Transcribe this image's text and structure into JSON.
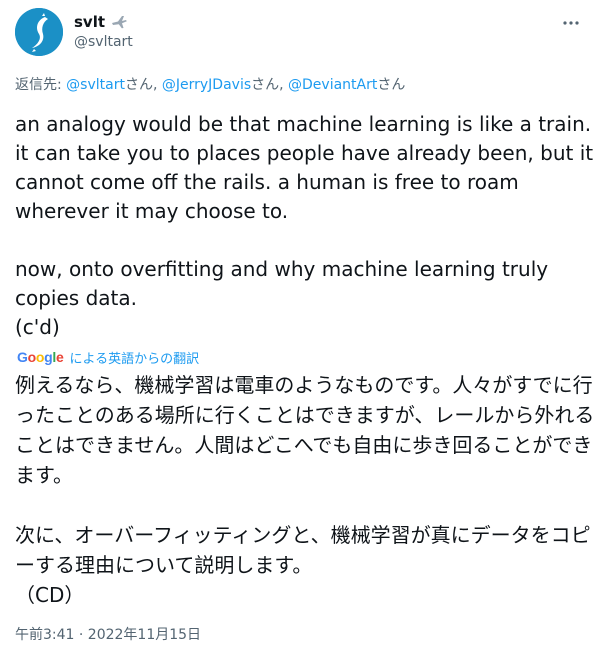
{
  "user": {
    "display_name": "svlt",
    "handle": "@svltart",
    "name_emoji_icon": "airplane-icon"
  },
  "reply": {
    "prefix": "返信先:",
    "mentions": [
      "@svltart",
      "@JerryJDavis",
      "@DeviantArt"
    ],
    "suffix": "さん",
    "separator": ", "
  },
  "tweet": {
    "paragraph1": "an analogy would be that machine learning is like a train. it can take you to places people have already been, but it cannot come off the rails. a human is free to roam wherever it may choose to.",
    "paragraph2": "now, onto overfitting and why machine learning truly copies data.",
    "paragraph3": "(c'd)"
  },
  "translation": {
    "provider": "Google",
    "label": "による英語からの翻訳",
    "paragraph1": "例えるなら、機械学習は電車のようなものです。人々がすでに行ったことのある場所に行くことはできますが、レールから外れることはできません。人間はどこへでも自由に歩き回ることができます。",
    "paragraph2": "次に、オーバーフィッティングと、機械学習が真にデータをコピーする理由について説明します。",
    "paragraph3": "（CD）"
  },
  "timestamp": "午前3:41 · 2022年11月15日",
  "colors": {
    "link": "#1d9bf0",
    "secondary_text": "#536471",
    "avatar_bg": "#1b90c6"
  },
  "icons": {
    "more": "more-horizontal-icon",
    "avatar": "avatar"
  }
}
